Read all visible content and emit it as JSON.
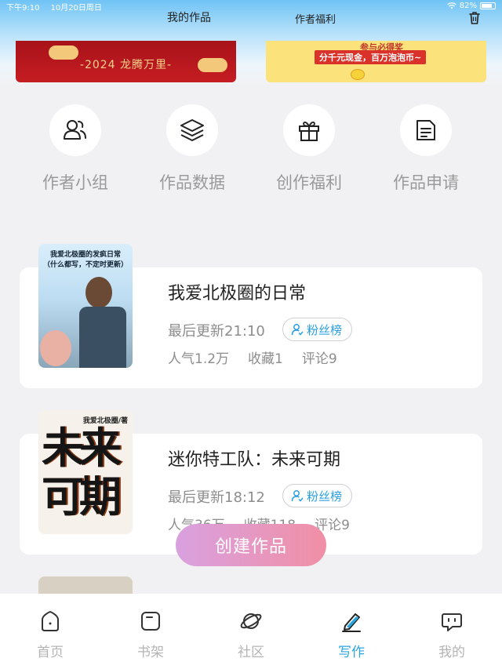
{
  "status_bar": {
    "time": "下午9:10",
    "date": "10月20日周日",
    "battery": "82%"
  },
  "header": {
    "tab_works": "我的作品",
    "tab_welfare": "作者福利"
  },
  "banners": {
    "left_text": "-2024 龙腾万里-",
    "right_line1": "参与必得奖",
    "right_line2": "分千元现金，百万泡泡币~"
  },
  "quick_actions": [
    {
      "label": "作者小组",
      "icon": "people-icon"
    },
    {
      "label": "作品数据",
      "icon": "layers-icon"
    },
    {
      "label": "创作福利",
      "icon": "gift-icon"
    },
    {
      "label": "作品申请",
      "icon": "document-icon"
    }
  ],
  "works": [
    {
      "title": "我爱北极圈的日常",
      "update": "最后更新21:10",
      "fans_label": "粉丝榜",
      "popularity": "人气1.2万",
      "favorites": "收藏1",
      "comments": "评论9",
      "cover_text": "我爱北极圈的发疯日常\n（什么都写，不定时更新）"
    },
    {
      "title": "迷你特工队：未来可期",
      "update": "最后更新18:12",
      "fans_label": "粉丝榜",
      "popularity": "人气36万",
      "favorites": "收藏118",
      "comments": "评论9",
      "cover_author": "我爱北极圈/著",
      "cover_big": "未来可期"
    }
  ],
  "create_button": "创建作品",
  "bottom_nav": [
    {
      "label": "首页",
      "icon": "home-icon",
      "active": false
    },
    {
      "label": "书架",
      "icon": "bookshelf-icon",
      "active": false
    },
    {
      "label": "社区",
      "icon": "planet-icon",
      "active": false
    },
    {
      "label": "写作",
      "icon": "pen-icon",
      "active": true
    },
    {
      "label": "我的",
      "icon": "chat-icon",
      "active": false
    }
  ],
  "colors": {
    "accent": "#2aa6df",
    "create_gradient_start": "#d9a1e0",
    "create_gradient_end": "#f18fa5",
    "banner_red": "#c51d22",
    "banner_yellow": "#fbe27a"
  }
}
